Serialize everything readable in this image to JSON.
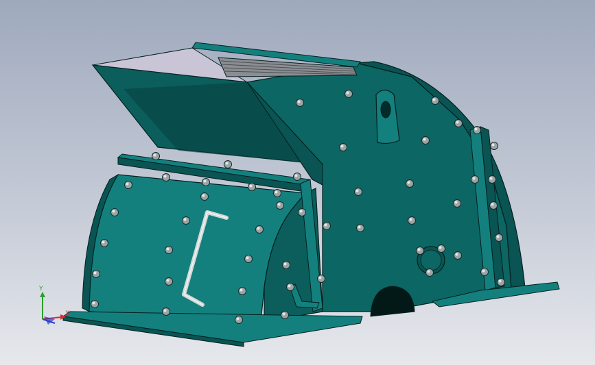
{
  "viewport": {
    "background_top": "#9fa9bd",
    "background_bottom": "#e6e8ec"
  },
  "model": {
    "body_color": "#0c6663",
    "body_dark": "#053a39",
    "body_mid": "#0a5453",
    "face_color": "#13807e",
    "edge_color": "#02201f",
    "bolt_color": "#9aa5a5",
    "handle_color": "#d4d8d8",
    "grille_color": "#8a8d91"
  },
  "triad": {
    "x_label": "X",
    "y_label": "Y",
    "x_color": "#d03030",
    "y_color": "#2aa02a",
    "z_color": "#2a3ccf",
    "icon": "view-orientation-triad-icon"
  }
}
